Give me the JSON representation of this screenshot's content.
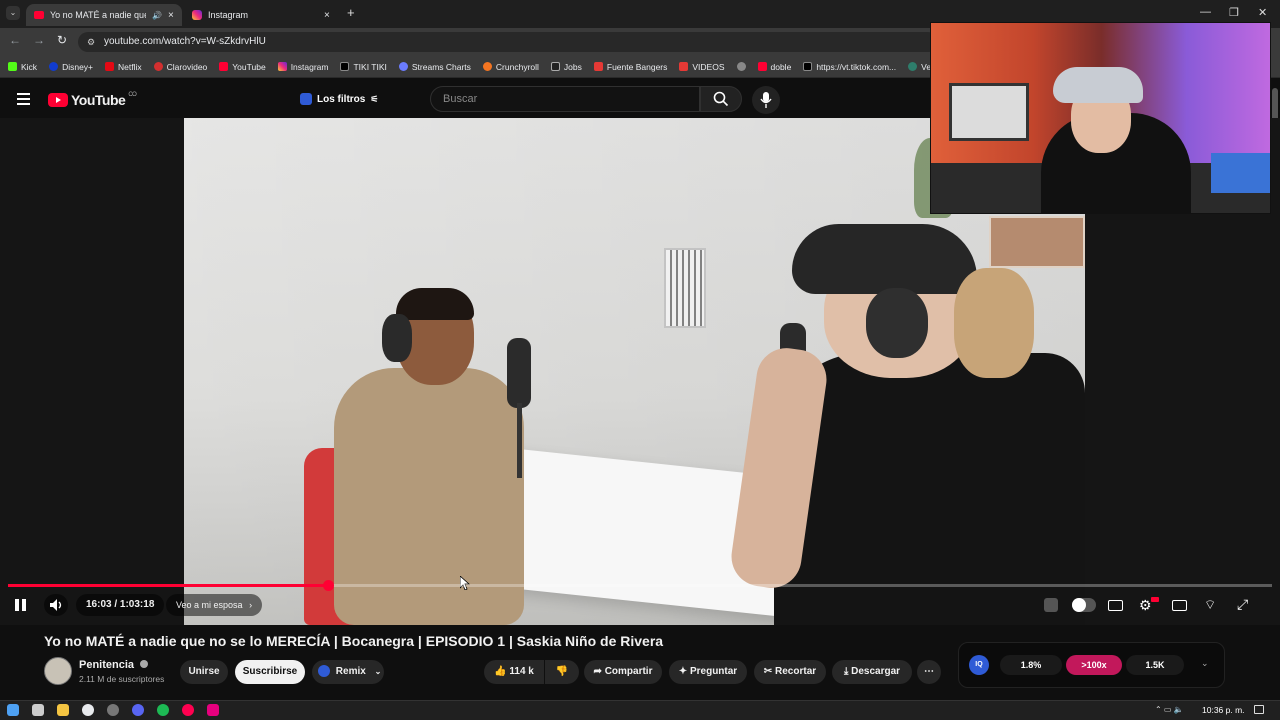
{
  "browser": {
    "tabs": [
      {
        "label": "Yo no MATÉ a nadie que no",
        "active": true
      },
      {
        "label": "Instagram",
        "active": false
      }
    ],
    "url": "youtube.com/watch?v=W-sZkdrvHlU",
    "bookmarks": [
      "Kick",
      "Disney+",
      "Netflix",
      "Clarovideo",
      "YouTube",
      "Instagram",
      "TIKI TIKI",
      "Streams Charts",
      "Crunchyroll",
      "Jobs",
      "Fuente Bangers",
      "VIDEOS",
      "doble",
      "https://vt.tiktok.com...",
      "Ver Patch A"
    ]
  },
  "youtube": {
    "logo_text": "YouTube",
    "country_code": "CO",
    "filters_label": "Los filtros",
    "search_placeholder": "Buscar"
  },
  "player": {
    "time": "16:03 / 1:03:18",
    "chapter": "Veo a mi esposa",
    "progress": 0.253,
    "state": "playing"
  },
  "video": {
    "title": "Yo no MATÉ a nadie que no se lo MERECÍA | Bocanegra | EPISODIO 1 | Saskia Niño de Rivera",
    "channel": "Penitencia",
    "subscribers": "2.11 M de suscriptores",
    "buttons": {
      "join": "Unirse",
      "subscribe": "Suscribirse",
      "remix": "Remix",
      "likes": "114 k",
      "share": "Compartir",
      "ask": "Preguntar",
      "clip": "Recortar",
      "download": "Descargar"
    }
  },
  "stats_widget": {
    "values": [
      "1.8%",
      ">100x",
      "1.5K"
    ],
    "accent": "#c2185b"
  },
  "taskbar": {
    "clock": "10:36 p. m."
  },
  "colors": {
    "yt_red": "#ff0033",
    "background": "#0f0f0f"
  }
}
